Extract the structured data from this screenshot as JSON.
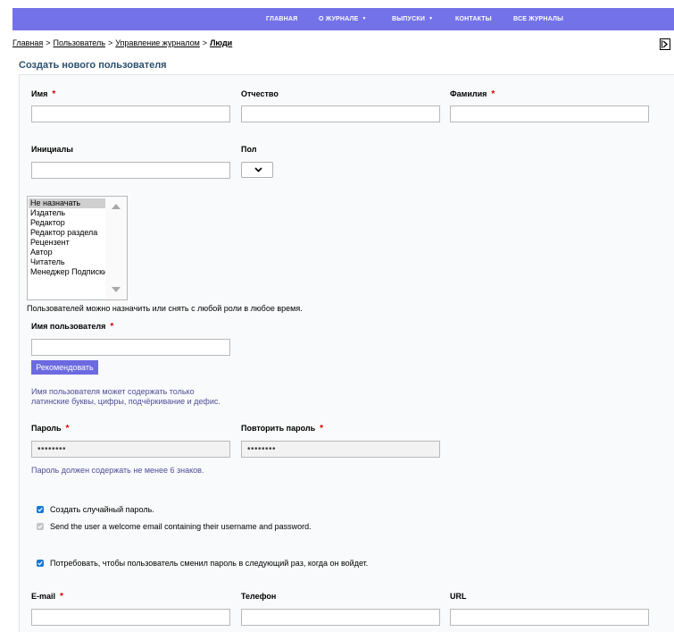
{
  "nav": {
    "home": "ГЛАВНАЯ",
    "about": "О ЖУРНАЛЕ",
    "issues": "ВЫПУСКИ",
    "contacts": "КОНТАКТЫ",
    "all_journals": "ВСЕ ЖУРНАЛЫ"
  },
  "breadcrumb": {
    "home": "Главная",
    "user": "Пользователь",
    "journal_mgmt": "Управление журналом",
    "current": "Люди",
    "separator": ">"
  },
  "form": {
    "title": "Создать нового пользователя",
    "required_mark": "*",
    "first_name_label": "Имя",
    "middle_name_label": "Отчество",
    "last_name_label": "Фамилия",
    "initials_label": "Инициалы",
    "gender_label": "Пол",
    "roles": [
      "Не назначать",
      "Издатель",
      "Редактор",
      "Редактор раздела",
      "Рецензент",
      "Автор",
      "Читатель",
      "Менеджер Подписки"
    ],
    "roles_note": "Пользователей можно назначить или снять с любой роли в любое время.",
    "username_label": "Имя пользователя",
    "suggest_button": "Рекомендовать",
    "username_hint_line1": "Имя пользователя может содержать только",
    "username_hint_line2": "латинские буквы, цифры, подчёркивание и дефис.",
    "password_label": "Пароль",
    "password_value": "••••••••",
    "repeat_password_label": "Повторить пароль",
    "repeat_password_value": "••••••••",
    "password_hint": "Пароль должен содержать не менее 6 знаков.",
    "random_password_label": "Создать случайный пароль.",
    "welcome_email_label": "Send the user a welcome email containing their username and password.",
    "change_password_label": "Потребовать, чтобы пользователь сменил пароль в следующий раз, когда он войдет.",
    "email_label": "E-mail",
    "phone_label": "Телефон",
    "url_label": "URL"
  },
  "colors": {
    "nav_bg": "#7472e8",
    "button_bg": "#6c6ae0",
    "required": "#d00000",
    "hint_text": "#4e4e98",
    "checkbox": "#1976d2"
  }
}
